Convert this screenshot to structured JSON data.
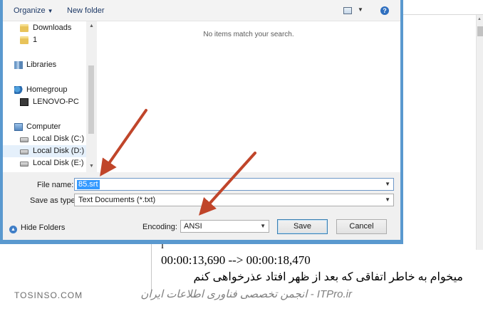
{
  "toolbar": {
    "organize_label": "Organize",
    "new_folder_label": "New folder"
  },
  "nav": {
    "items": [
      {
        "label": "Downloads",
        "icon": "folder-icon"
      },
      {
        "label": "1",
        "icon": "folder-icon"
      },
      {
        "label": "Libraries",
        "icon": "libraries-icon"
      },
      {
        "label": "Homegroup",
        "icon": "homegroup-icon"
      },
      {
        "label": "LENOVO-PC",
        "icon": "pc-icon"
      },
      {
        "label": "Computer",
        "icon": "computer-icon"
      },
      {
        "label": "Local Disk (C:)",
        "icon": "disk-icon"
      },
      {
        "label": "Local Disk (D:)",
        "icon": "disk-icon",
        "selected": true
      },
      {
        "label": "Local Disk (E:)",
        "icon": "disk-icon"
      }
    ]
  },
  "content": {
    "empty_message": "No items match your search."
  },
  "form": {
    "file_name_label": "File name:",
    "file_name_value": "85.srt",
    "save_as_type_label": "Save as type:",
    "save_as_type_value": "Text Documents (*.txt)",
    "encoding_label": "Encoding:",
    "encoding_value": "ANSI"
  },
  "footer": {
    "hide_folders_label": "Hide Folders",
    "save_label": "Save",
    "cancel_label": "Cancel"
  },
  "background_doc": {
    "line_marker": "I",
    "timestamp": "00:00:13,690 --> 00:00:18,470",
    "subtitle": "میخوام به خاطر اتفاقی که بعد از ظهر افتاد عذرخواهی کنم"
  },
  "watermarks": {
    "left": "TOSINSO.COM",
    "right": "ITPro.ir - انجمن تخصصی فناوری اطلاعات ایران"
  },
  "colors": {
    "dialog_border": "#5a99cf",
    "selection": "#3399ff",
    "arrow": "#c0452a"
  }
}
